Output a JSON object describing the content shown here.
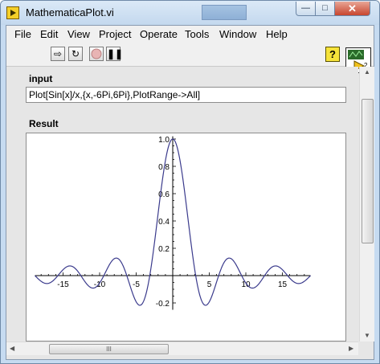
{
  "window": {
    "title": "MathematicaPlot.vi"
  },
  "menu": [
    "File",
    "Edit",
    "View",
    "Project",
    "Operate",
    "Tools",
    "Window",
    "Help"
  ],
  "toolbar": {
    "help_label": "?",
    "vi_icon_text": "2"
  },
  "input": {
    "label": "input",
    "value": "Plot[Sin[x]/x,{x,-6Pi,6Pi},PlotRange->All]"
  },
  "result": {
    "label": "Result"
  },
  "hscroll": {
    "grip": "III"
  },
  "chart_data": {
    "type": "line",
    "function": "Sin[x]/x",
    "x_range": [
      -18.85,
      18.85
    ],
    "xticks": [
      -15,
      -10,
      -5,
      5,
      10,
      15
    ],
    "yticks": [
      -0.2,
      0.2,
      0.4,
      0.6,
      0.8,
      1.0
    ],
    "ytick_labels": [
      "-0.2",
      "0.2",
      "0.4",
      "0.6",
      "0.8",
      "1.0"
    ],
    "xtick_labels": [
      "-15",
      "-10",
      "-5",
      "5",
      "10",
      "15"
    ],
    "ylim": [
      -0.25,
      1.0
    ],
    "line_color": "#3a3a8c"
  }
}
